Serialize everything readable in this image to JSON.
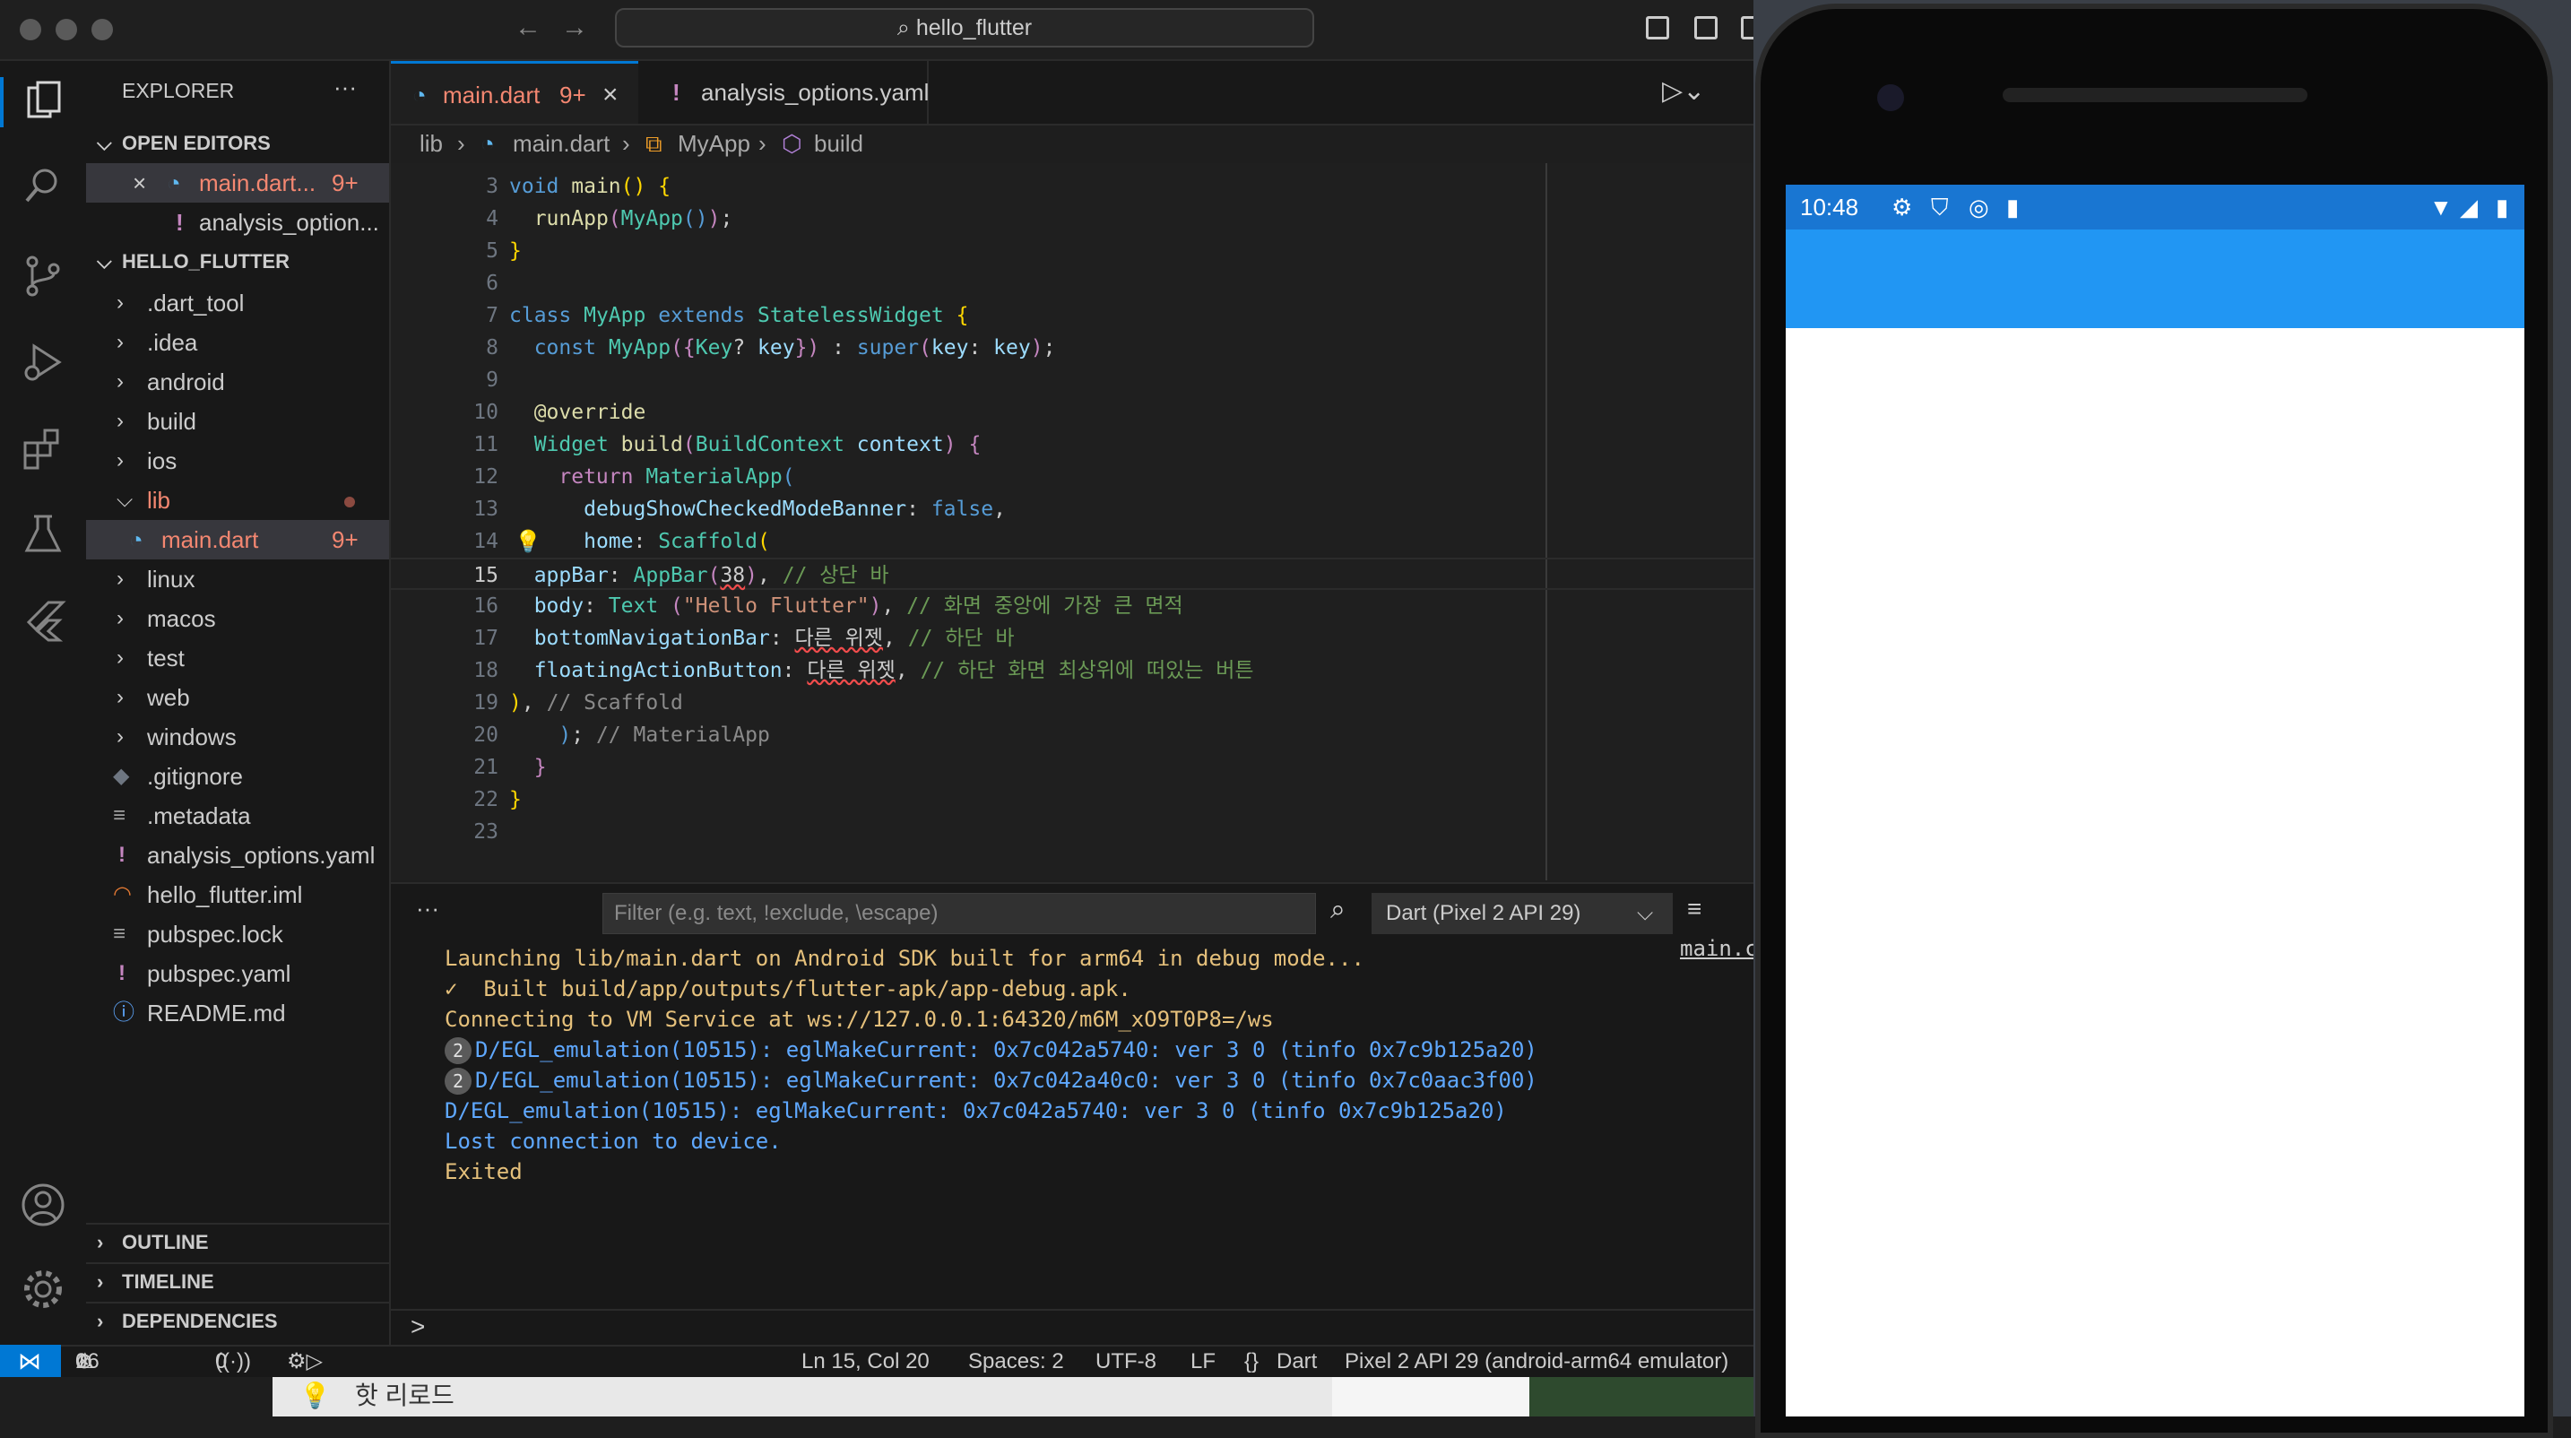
{
  "window": {
    "search": "hello_flutter"
  },
  "sidebar": {
    "title": "EXPLORER",
    "more": "···",
    "open_editors_title": "OPEN EDITORS",
    "open_editors": [
      {
        "close": "×",
        "label": "main.dart...",
        "badge": "9+"
      },
      {
        "label": "analysis_option..."
      }
    ],
    "project_title": "HELLO_FLUTTER",
    "tree": [
      {
        "label": ".dart_tool",
        "type": "folder"
      },
      {
        "label": ".idea",
        "type": "folder"
      },
      {
        "label": "android",
        "type": "folder"
      },
      {
        "label": "build",
        "type": "folder"
      },
      {
        "label": "ios",
        "type": "folder"
      },
      {
        "label": "lib",
        "type": "folder-open"
      },
      {
        "label": "main.dart",
        "type": "file",
        "badge": "9+"
      },
      {
        "label": "linux",
        "type": "folder"
      },
      {
        "label": "macos",
        "type": "folder"
      },
      {
        "label": "test",
        "type": "folder"
      },
      {
        "label": "web",
        "type": "folder"
      },
      {
        "label": "windows",
        "type": "folder"
      },
      {
        "label": ".gitignore",
        "type": "file"
      },
      {
        "label": ".metadata",
        "type": "file"
      },
      {
        "label": "analysis_options.yaml",
        "type": "file"
      },
      {
        "label": "hello_flutter.iml",
        "type": "file"
      },
      {
        "label": "pubspec.lock",
        "type": "file"
      },
      {
        "label": "pubspec.yaml",
        "type": "file"
      },
      {
        "label": "README.md",
        "type": "file"
      }
    ],
    "outline": "OUTLINE",
    "timeline": "TIMELINE",
    "dependencies": "DEPENDENCIES"
  },
  "tabs": [
    {
      "label": "main.dart",
      "badge": "9+",
      "close": "×"
    },
    {
      "label": "analysis_options.yaml"
    }
  ],
  "breadcrumb": [
    "lib",
    "main.dart",
    "MyApp",
    "build"
  ],
  "code": {
    "line_numbers": [
      "3",
      "4",
      "5",
      "6",
      "7",
      "8",
      "9",
      "10",
      "11",
      "12",
      "13",
      "14",
      "15",
      "16",
      "17",
      "18",
      "19",
      "20",
      "21",
      "22",
      "23"
    ]
  },
  "panel": {
    "more": "···",
    "filter_placeholder": "Filter (e.g. text, !exclude, \\escape)",
    "device": "Dart (Pixel 2 API 29)",
    "link": "main.c",
    "output": [
      {
        "text": "Launching lib/main.dart on Android SDK built for arm64 in debug mode...",
        "color": "y"
      },
      {
        "text": "✓  Built build/app/outputs/flutter-apk/app-debug.apk.",
        "color": "y"
      },
      {
        "text": "Connecting to VM Service at ws://127.0.0.1:64320/m6M_xO9T0P8=/ws",
        "color": "y"
      },
      {
        "count": "2",
        "text": "D/EGL_emulation(10515): eglMakeCurrent: 0x7c042a5740: ver 3 0 (tinfo 0x7c9b125a20)",
        "color": "b"
      },
      {
        "count": "2",
        "text": "D/EGL_emulation(10515): eglMakeCurrent: 0x7c042a40c0: ver 3 0 (tinfo 0x7c0aac3f00)",
        "color": "b"
      },
      {
        "text": "D/EGL_emulation(10515): eglMakeCurrent: 0x7c042a5740: ver 3 0 (tinfo 0x7c9b125a20)",
        "color": "b"
      },
      {
        "text": "Lost connection to device.",
        "color": "b"
      },
      {
        "text": "Exited",
        "color": "y"
      }
    ],
    "prompt": ">"
  },
  "statusbar": {
    "errors": "16",
    "warnings": "0",
    "ports": "0",
    "position": "Ln 15, Col 20",
    "spaces": "Spaces: 2",
    "encoding": "UTF-8",
    "eol": "LF",
    "language": "Dart",
    "device": "Pixel 2 API 29 (android-arm64 emulator)"
  },
  "phone": {
    "time": "10:48"
  },
  "dock": {
    "label": "핫 리로드"
  },
  "colors": {
    "accent": "#0078d4",
    "app_bar": "#2196f3",
    "status_bar": "#1976d2"
  }
}
